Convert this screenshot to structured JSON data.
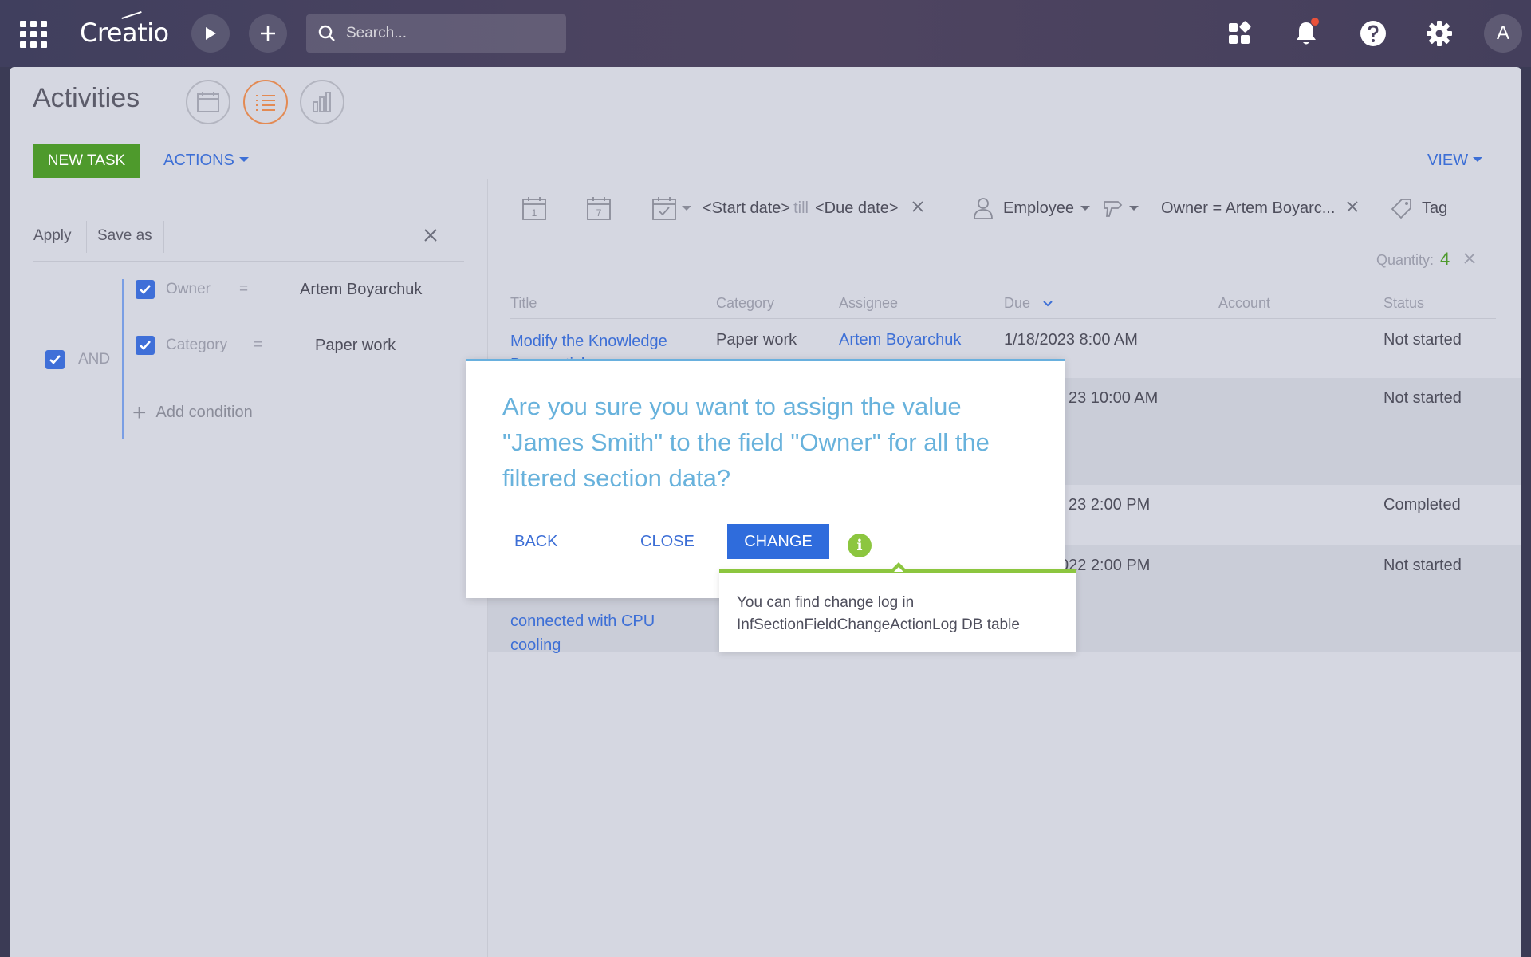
{
  "topbar": {
    "logo": "Creatio",
    "search_placeholder": "Search...",
    "avatar_initial": "A"
  },
  "page": {
    "title": "Activities",
    "new_task_label": "NEW TASK",
    "actions_label": "ACTIONS",
    "view_label": "VIEW"
  },
  "filter_panel": {
    "apply_label": "Apply",
    "save_as_label": "Save as",
    "group_operator": "AND",
    "conditions": [
      {
        "field": "Owner",
        "operator": "=",
        "value": "Artem Boyarchuk"
      },
      {
        "field": "Category",
        "operator": "=",
        "value": "Paper work"
      }
    ],
    "add_condition_label": "Add condition"
  },
  "quick_filters": {
    "start_date": "<Start date>",
    "till": "till",
    "due_date": "<Due date>",
    "employee_label": "Employee",
    "owner_filter": "Owner = Artem Boyarc...",
    "tag_label": "Tag",
    "quantity_label": "Quantity:",
    "quantity_value": "4",
    "calendar_day_number": "1",
    "calendar_week_number": "7"
  },
  "grid": {
    "columns": [
      "Title",
      "Category",
      "Assignee",
      "Due",
      "Account",
      "Status"
    ],
    "rows": [
      {
        "title": "Modify the Knowledge",
        "title_line2": "Base article",
        "category": "Paper work",
        "assignee": "Artem Boyarchuk",
        "due": "1/18/2023 8:00 AM",
        "account": "",
        "status": "Not started"
      },
      {
        "title": "",
        "category": "",
        "assignee": "",
        "due": "23 10:00 AM",
        "account": "",
        "status": "Not started"
      },
      {
        "title": "",
        "category": "",
        "assignee": "",
        "due": "23 2:00 PM",
        "account": "",
        "status": "Completed"
      },
      {
        "title": "connected with CPU",
        "title_line2": "cooling",
        "category": "",
        "assignee": "",
        "due": "022 2:00 PM",
        "account": "",
        "status": "Not started"
      }
    ]
  },
  "dialog": {
    "message": "Are you sure you want to assign the value \"James Smith\" to the field \"Owner\" for all the filtered section data?",
    "back_label": "BACK",
    "close_label": "CLOSE",
    "change_label": "CHANGE",
    "info_glyph": "i",
    "tooltip_line1": "You can find change log in",
    "tooltip_line2": "InfSectionFieldChangeActionLog DB table"
  },
  "colors": {
    "accent_blue": "#3d6fd6",
    "primary_button": "#2f6cdc",
    "new_task_green": "#4e9a2c",
    "info_green": "#8cc63f",
    "dialog_text": "#68b2dc",
    "active_view_border": "#e38a53"
  },
  "icons": [
    "apps-grid-icon",
    "play-icon",
    "plus-icon",
    "search-icon",
    "widgets-icon",
    "bell-icon",
    "help-icon",
    "gear-icon",
    "calendar-view-icon",
    "list-view-icon",
    "chart-view-icon",
    "close-icon",
    "checkbox-checked-icon",
    "calendar-day-icon",
    "calendar-week-icon",
    "calendar-check-icon",
    "person-icon",
    "thumb-icon",
    "tag-icon",
    "chevron-down-icon",
    "info-icon"
  ]
}
